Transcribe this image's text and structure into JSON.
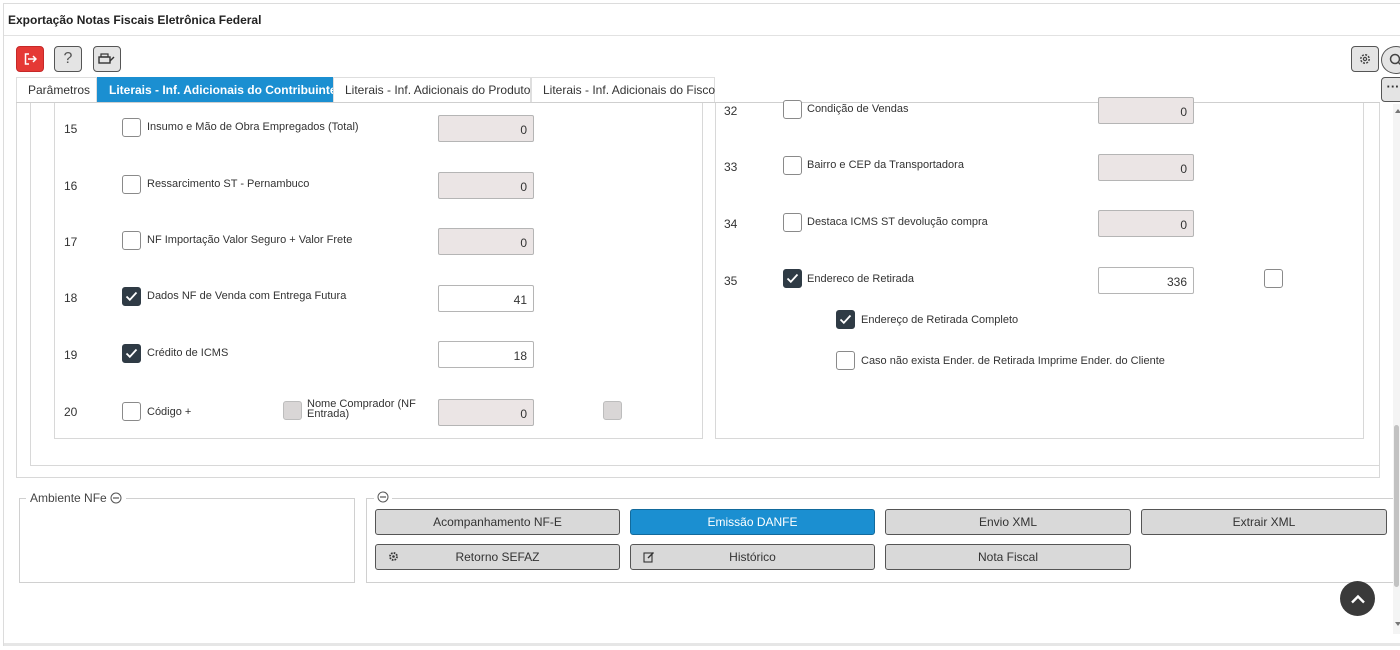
{
  "window": {
    "title": "Exportação Notas Fiscais Eletrônica Federal"
  },
  "toolbar": {
    "help_label": "?"
  },
  "tabs": [
    {
      "label": "Parâmetros"
    },
    {
      "label": "Literais - Inf. Adicionais do Contribuinte"
    },
    {
      "label": "Literais - Inf. Adicionais do Produto"
    },
    {
      "label": "Literais - Inf. Adicionais do Fisco"
    }
  ],
  "left_rows": [
    {
      "num": "15",
      "label": "Insumo e Mão de Obra Empregados (Total)",
      "checked": false,
      "value": "0"
    },
    {
      "num": "16",
      "label": "Ressarcimento ST - Pernambuco",
      "checked": false,
      "value": "0"
    },
    {
      "num": "17",
      "label": "NF Importação Valor Seguro + Valor Frete",
      "checked": false,
      "value": "0"
    },
    {
      "num": "18",
      "label": "Dados NF de Venda com Entrega Futura",
      "checked": true,
      "value": "41"
    },
    {
      "num": "19",
      "label": "Crédito de ICMS",
      "checked": true,
      "value": "18"
    },
    {
      "num": "20",
      "label": "Código +",
      "checked": false,
      "value": "0",
      "extra_label": "Nome Comprador (NF Entrada)"
    }
  ],
  "right_rows": [
    {
      "num": "32",
      "label": "Condição de Vendas",
      "checked": false,
      "value": "0"
    },
    {
      "num": "33",
      "label": "Bairro e CEP da Transportadora",
      "checked": false,
      "value": "0"
    },
    {
      "num": "34",
      "label": "Destaca ICMS ST devolução compra",
      "checked": false,
      "value": "0"
    },
    {
      "num": "35",
      "label": "Endereco de Retirada",
      "checked": true,
      "value": "336"
    }
  ],
  "sub_options": [
    {
      "label": "Endereço de Retirada Completo",
      "checked": true
    },
    {
      "label": "Caso não exista Ender. de Retirada Imprime Ender. do Cliente",
      "checked": false
    }
  ],
  "ambiente": {
    "label": "Ambiente NFe"
  },
  "actions": [
    {
      "label": "Acompanhamento NF-E",
      "icon": ""
    },
    {
      "label": "Emissão DANFE",
      "icon": ""
    },
    {
      "label": "Envio XML",
      "icon": ""
    },
    {
      "label": "Extrair XML",
      "icon": ""
    },
    {
      "label": "Retorno SEFAZ",
      "icon": "gear-icon"
    },
    {
      "label": "Histórico",
      "icon": "edit-icon"
    },
    {
      "label": "Nota Fiscal",
      "icon": ""
    }
  ],
  "colors": {
    "accent": "#1b8fd1",
    "exit": "#e53935",
    "checkbox_checked": "#2f3b45",
    "readonly_field": "#ebe5e5"
  }
}
